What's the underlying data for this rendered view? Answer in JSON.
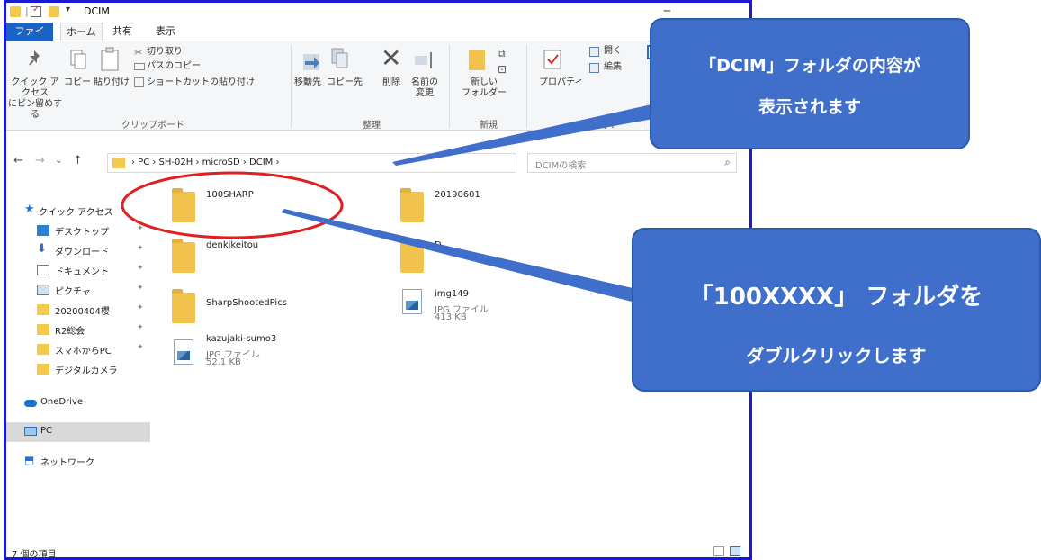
{
  "window": {
    "title": "DCIM",
    "quick_access_sep": "|",
    "quick_access_dropdown": "▾",
    "minimize_glyph": "─"
  },
  "tabs": [
    {
      "label": "ファイル"
    },
    {
      "label": "ホーム"
    },
    {
      "label": "共有"
    },
    {
      "label": "表示"
    }
  ],
  "ribbon": {
    "pin_quick_access": "クイック アクセス\nにピン留めする",
    "copy": "コピー",
    "paste": "貼り付け",
    "cut": "切り取り",
    "copy_path": "パスのコピー",
    "paste_shortcut": "ショートカットの貼り付け",
    "group_clipboard": "クリップボード",
    "move_to": "移動先",
    "copy_to": "コピー先",
    "delete": "削除",
    "rename": "名前の\n変更",
    "group_organize": "整理",
    "new_folder": "新しい\nフォルダー",
    "group_new": "新規",
    "properties": "プロパティ",
    "open": "開く",
    "edit": "編集",
    "group_open": "開く"
  },
  "address": {
    "crumbs": "›  PC  ›  SH-02H  ›  microSD  ›  DCIM  ›",
    "dropdown": "⌄",
    "refresh": "↻",
    "back": "←",
    "forward": "→",
    "recent": "⌄",
    "up": "↑"
  },
  "search": {
    "placeholder": "DCIMの検索",
    "icon": "⌕"
  },
  "nav": {
    "items": [
      {
        "label": "クイック アクセス",
        "icon": "star-icon"
      },
      {
        "label": "デスクトップ",
        "icon": "desktop-icon",
        "pin": "📌"
      },
      {
        "label": "ダウンロード",
        "icon": "download-icon",
        "pin": "📌"
      },
      {
        "label": "ドキュメント",
        "icon": "document-icon",
        "pin": "📌"
      },
      {
        "label": "ピクチャ",
        "icon": "pictures-icon",
        "pin": "📌"
      },
      {
        "label": "20200404櫻",
        "icon": "folder-icon",
        "pin": "📌"
      },
      {
        "label": "R2総会",
        "icon": "folder-icon",
        "pin": "📌"
      },
      {
        "label": "スマホからPC",
        "icon": "folder-icon",
        "pin": "📌"
      },
      {
        "label": "デジタルカメラ",
        "icon": "folder-icon"
      },
      {
        "label": "OneDrive",
        "icon": "cloud-icon"
      },
      {
        "label": "PC",
        "icon": "pc-icon"
      },
      {
        "label": "ネットワーク",
        "icon": "network-icon"
      }
    ]
  },
  "files": [
    {
      "name": "100SHARP",
      "kind": "folder"
    },
    {
      "name": "20190601",
      "kind": "folder"
    },
    {
      "name": "denkikeitou",
      "kind": "folder"
    },
    {
      "name": "D",
      "kind": "folder"
    },
    {
      "name": "SharpShootedPics",
      "kind": "folder"
    },
    {
      "name": "img149",
      "kind": "image",
      "type": "JPG ファイル",
      "size": "413 KB"
    },
    {
      "name": "kazujaki-sumo3",
      "kind": "image",
      "type": "JPG ファイル",
      "size": "52.1 KB"
    }
  ],
  "status": {
    "text": "7 個の項目"
  },
  "callouts": {
    "top_line1": "「DCIM」フォルダの内容が",
    "top_line2": "表示されます",
    "bottom_line1": "「100XXXX」 フォルダを",
    "bottom_line2": "ダブルクリックします"
  },
  "colors": {
    "window_border": "#1a1ad0",
    "file_tab": "#1a63c6",
    "callout_fill": "#3f6fcb",
    "highlight_ellipse": "#e02020",
    "folder": "#f1c34d"
  }
}
